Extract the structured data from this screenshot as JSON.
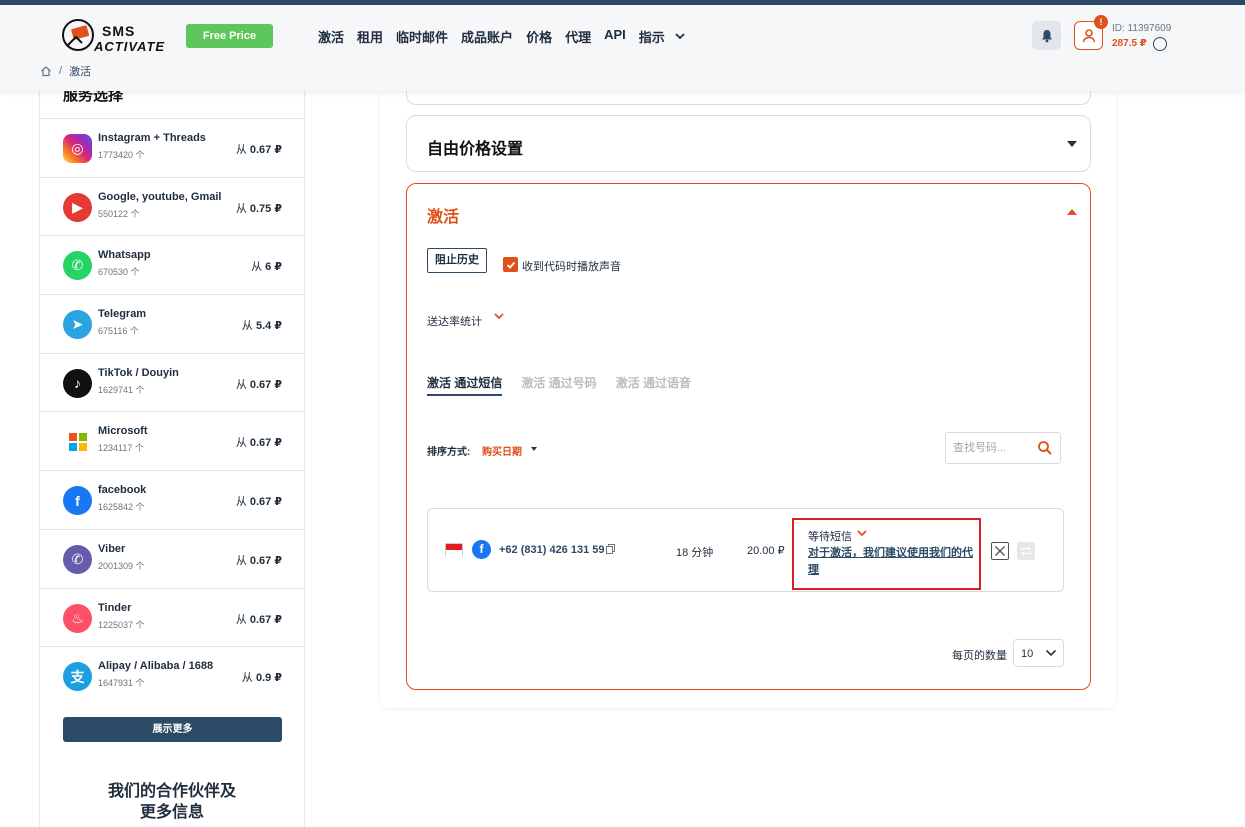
{
  "header": {
    "logo_line1": "SMS",
    "logo_line2": "ACTIVATE",
    "free_price_label": "Free Price",
    "nav": [
      "激活",
      "租用",
      "临时邮件",
      "成品账户",
      "价格",
      "代理",
      "API",
      "指示"
    ],
    "user_id": "ID: 11397609",
    "balance": "287.5 ₽",
    "notification_badge": "!"
  },
  "breadcrumb": {
    "current": "激活"
  },
  "sidebar": {
    "title": "服务选择",
    "services": [
      {
        "name": "Instagram + Threads",
        "count": "1773420 个",
        "price_prefix": "从",
        "price": "0.67 ₽",
        "icon": "instagram-icon",
        "color": "#d62976"
      },
      {
        "name": "Google, youtube, Gmail",
        "count": "550122 个",
        "price_prefix": "从",
        "price": "0.75 ₽",
        "icon": "youtube-icon",
        "color": "#e53935"
      },
      {
        "name": "Whatsapp",
        "count": "670530 个",
        "price_prefix": "从",
        "price": "6 ₽",
        "icon": "whatsapp-icon",
        "color": "#25d366"
      },
      {
        "name": "Telegram",
        "count": "675116 个",
        "price_prefix": "从",
        "price": "5.4 ₽",
        "icon": "telegram-icon",
        "color": "#2aa3e0"
      },
      {
        "name": "TikTok / Douyin",
        "count": "1629741 个",
        "price_prefix": "从",
        "price": "0.67 ₽",
        "icon": "tiktok-icon",
        "color": "#111111"
      },
      {
        "name": "Microsoft",
        "count": "1234117 个",
        "price_prefix": "从",
        "price": "0.67 ₽",
        "icon": "microsoft-icon",
        "color": "#ffffff"
      },
      {
        "name": "facebook",
        "count": "1625842 个",
        "price_prefix": "从",
        "price": "0.67 ₽",
        "icon": "facebook-icon",
        "color": "#1877f2"
      },
      {
        "name": "Viber",
        "count": "2001309 个",
        "price_prefix": "从",
        "price": "0.67 ₽",
        "icon": "viber-icon",
        "color": "#665cac"
      },
      {
        "name": "Tinder",
        "count": "1225037 个",
        "price_prefix": "从",
        "price": "0.67 ₽",
        "icon": "tinder-icon",
        "color": "#fd5068"
      },
      {
        "name": "Alipay / Alibaba / 1688",
        "count": "1647931 个",
        "price_prefix": "从",
        "price": "0.9 ₽",
        "icon": "alipay-icon",
        "color": "#1a9fe0"
      }
    ],
    "show_more": "展示更多",
    "partners_line1": "我们的合作伙伴及",
    "partners_line2": "更多信息"
  },
  "main": {
    "free_price_section": "自由价格设置",
    "activation_section": "激活",
    "block_history": "阻止历史",
    "sound_label": "收到代码时播放声音",
    "sound_checked": true,
    "delivery_stats": "送达率统计",
    "tabs": [
      "激活 通过短信",
      "激活 通过号码",
      "激活 通过语音"
    ],
    "sort_label": "排序方式:",
    "sort_value": "购买日期",
    "search_placeholder": "查找号码...",
    "number": {
      "phone": "+62 (831) 426 131 59",
      "minutes": "18 分钟",
      "price": "20.00 ₽",
      "status": "等待短信",
      "recommendation": "对于激活，我们建议使用我们的代理"
    },
    "per_page_label": "每页的数量",
    "per_page_value": "10"
  },
  "colors": {
    "accent": "#e0501a",
    "navy": "#2d4a66",
    "green": "#5ec75b"
  }
}
